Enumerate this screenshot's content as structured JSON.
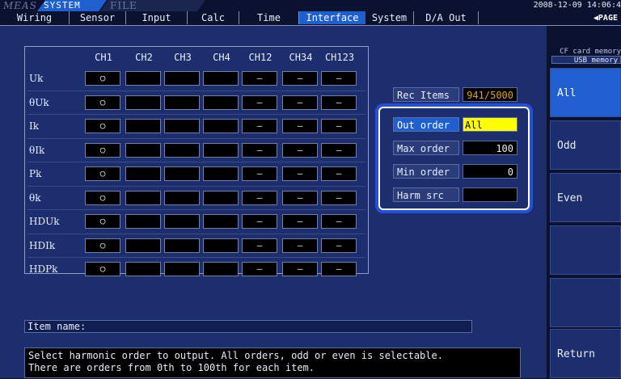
{
  "modes": {
    "meas": "MEAS",
    "system": "SYSTEM",
    "file": "FILE"
  },
  "clock": "2008-12-09 14:06:4",
  "tabs": [
    "Wiring",
    "Sensor",
    "Input",
    "Calc",
    "Time",
    "Interface",
    "System",
    "D/A Out"
  ],
  "active_tab": "Interface",
  "page_label": "PAGE",
  "grid": {
    "columns": [
      "CH1",
      "CH2",
      "CH3",
      "CH4",
      "CH12",
      "CH34",
      "CH123"
    ],
    "rows": [
      {
        "label": "Uk",
        "cells": [
          "○",
          "",
          "",
          "",
          "—",
          "—",
          "—"
        ]
      },
      {
        "label": "θUk",
        "cells": [
          "○",
          "",
          "",
          "",
          "—",
          "—",
          "—"
        ]
      },
      {
        "label": "Ik",
        "cells": [
          "○",
          "",
          "",
          "",
          "—",
          "—",
          "—"
        ]
      },
      {
        "label": "θIk",
        "cells": [
          "○",
          "",
          "",
          "",
          "—",
          "—",
          "—"
        ]
      },
      {
        "label": "Pk",
        "cells": [
          "○",
          "",
          "",
          "",
          "—",
          "—",
          "—"
        ]
      },
      {
        "label": "θk",
        "cells": [
          "○",
          "",
          "",
          "",
          "—",
          "—",
          "—"
        ]
      },
      {
        "label": "HDUk",
        "cells": [
          "○",
          "",
          "",
          "",
          "—",
          "—",
          "—"
        ]
      },
      {
        "label": "HDIk",
        "cells": [
          "○",
          "",
          "",
          "",
          "—",
          "—",
          "—"
        ]
      },
      {
        "label": "HDPk",
        "cells": [
          "○",
          "",
          "",
          "",
          "—",
          "—",
          "—"
        ]
      }
    ]
  },
  "rec_items": {
    "label": "Rec Items",
    "value": "941/5000"
  },
  "settings": [
    {
      "label": "Out order",
      "value": "All",
      "selected": true
    },
    {
      "label": "Max order",
      "value": "100"
    },
    {
      "label": "Min order",
      "value": "0"
    },
    {
      "label": "Harm src",
      "value": ""
    }
  ],
  "item_name_label": "Item name:",
  "message_lines": [
    "Select harmonic order to output. All orders, odd or even is selectable.",
    "There are orders from 0th to 100th for each item."
  ],
  "storage": {
    "cf": "CF card memory",
    "usb": "USB  memory"
  },
  "right_buttons": [
    "All",
    "Odd",
    "Even",
    "",
    "",
    "Return"
  ],
  "colors": {
    "accent": "#1f5fd0",
    "highlight": "#ffff00",
    "rec_value": "#e0a020"
  }
}
